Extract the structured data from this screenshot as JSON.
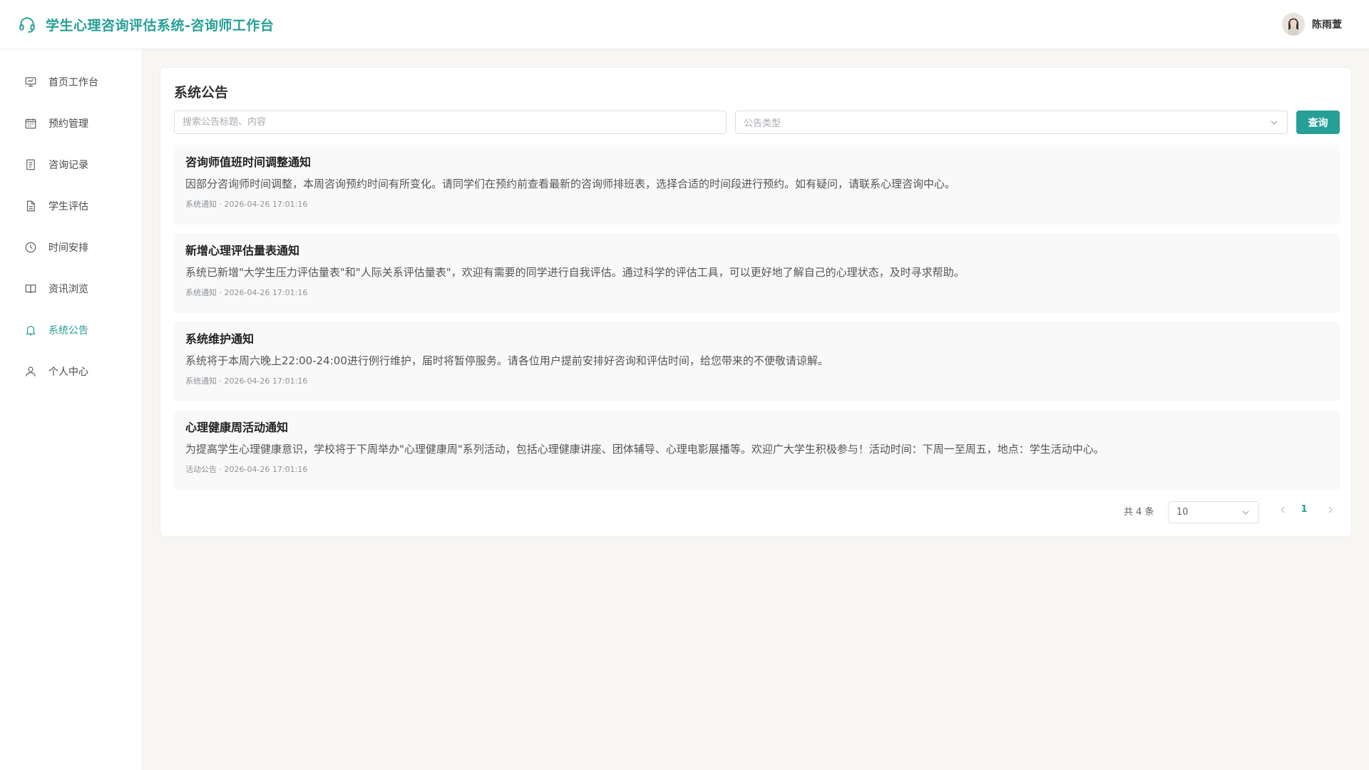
{
  "header": {
    "title": "学生心理咨询评估系统-咨询师工作台",
    "user_name": "陈雨萱"
  },
  "sidebar": {
    "items": [
      {
        "label": "首页工作台",
        "icon": "dashboard-icon"
      },
      {
        "label": "预约管理",
        "icon": "calendar-icon"
      },
      {
        "label": "咨询记录",
        "icon": "document-icon"
      },
      {
        "label": "学生评估",
        "icon": "file-text-icon"
      },
      {
        "label": "时间安排",
        "icon": "clock-icon"
      },
      {
        "label": "资讯浏览",
        "icon": "book-icon"
      },
      {
        "label": "系统公告",
        "icon": "bell-icon",
        "active": true
      },
      {
        "label": "个人中心",
        "icon": "user-icon"
      }
    ]
  },
  "main": {
    "title": "系统公告",
    "search_placeholder": "搜索公告标题、内容",
    "type_placeholder": "公告类型",
    "query_label": "查询",
    "notices": [
      {
        "title": "咨询师值班时间调整通知",
        "content": "因部分咨询师时间调整，本周咨询预约时间有所变化。请同学们在预约前查看最新的咨询师排班表，选择合适的时间段进行预约。如有疑问，请联系心理咨询中心。",
        "meta": "系统通知 · 2026-04-26 17:01:16"
      },
      {
        "title": "新增心理评估量表通知",
        "content": "系统已新增\"大学生压力评估量表\"和\"人际关系评估量表\"，欢迎有需要的同学进行自我评估。通过科学的评估工具，可以更好地了解自己的心理状态，及时寻求帮助。",
        "meta": "系统通知 · 2026-04-26 17:01:16"
      },
      {
        "title": "系统维护通知",
        "content": "系统将于本周六晚上22:00-24:00进行例行维护，届时将暂停服务。请各位用户提前安排好咨询和评估时间，给您带来的不便敬请谅解。",
        "meta": "系统通知 · 2026-04-26 17:01:16"
      },
      {
        "title": "心理健康周活动通知",
        "content": "为提高学生心理健康意识，学校将于下周举办\"心理健康周\"系列活动，包括心理健康讲座、团体辅导、心理电影展播等。欢迎广大学生积极参与！活动时间：下周一至周五，地点：学生活动中心。",
        "meta": "活动公告 · 2026-04-26 17:01:16"
      }
    ],
    "pagination": {
      "total_text": "共 4 条",
      "page_size": "10",
      "current_page": "1"
    }
  },
  "colors": {
    "accent": "#26a096",
    "background": "#f7f6f3"
  }
}
